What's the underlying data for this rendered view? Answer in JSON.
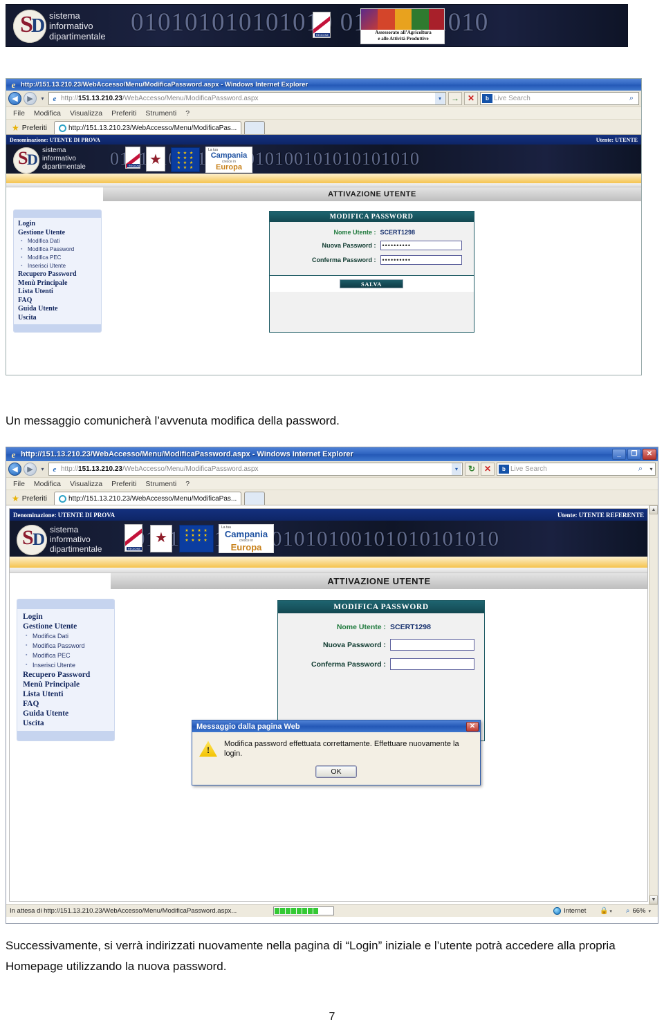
{
  "document": {
    "paragraph_top": "Un messaggio comunicherà l’avvenuta modifica della password.",
    "paragraph_bottom": "Successivamente, si verrà indirizzati nuovamente nella pagina di “Login” iniziale e l’utente potrà accedere alla propria Homepage utilizzando la nuova password.",
    "page_number": "7"
  },
  "masthead": {
    "logo_line1": "sistema",
    "logo_line2": "informativo",
    "logo_line3": "dipartimentale",
    "binary_pattern": "010101010101010                 01010101010",
    "regione_caption": "REGIONE CAMPANIA",
    "agri_caption_line1": "Assessorato all’Agricoltura",
    "agri_caption_line2": "e alle Attività Produttive"
  },
  "browser": {
    "title": "http://151.13.210.23/WebAccesso/Menu/ModificaPassword.aspx - Windows Internet Explorer",
    "address_host": "151.13.210.23",
    "address_prefix": "http://",
    "address_path": "/WebAccesso/Menu/ModificaPassword.aspx",
    "search_placeholder": "Live Search",
    "search_brand": "b",
    "menu": [
      "File",
      "Modifica",
      "Visualizza",
      "Preferiti",
      "Strumenti",
      "?"
    ],
    "favorites_label": "Preferiti",
    "tab_label": "http://151.13.210.23/WebAccesso/Menu/ModificaPas...",
    "minimize_glyph": "_",
    "restore_glyph": "❐",
    "close_glyph": "✕",
    "back_glyph": "◀",
    "forward_glyph": "▶",
    "dropdown_glyph": "▾",
    "go_glyph": "→",
    "refresh_glyph": "↻",
    "stop_glyph": "✕",
    "search_go_glyph": "⌕"
  },
  "status_bar": {
    "text": "In attesa di http://151.13.210.23/WebAccesso/Menu/ModificaPassword.aspx...",
    "zone": "Internet",
    "zoom": "66%",
    "progress_blocks": 8
  },
  "app": {
    "denominazione_label": "Denominazione:",
    "denominazione_value": "UTENTE DI PROVA",
    "utente_label": "Utente:",
    "utente_value_window1": "UTENTE",
    "utente_value_window2": "UTENTE REFERENTE",
    "page_title": "ATTIVAZIONE UTENTE",
    "banner_binary": "01010101010101010100101010101010",
    "crests": {
      "campania_caption": "REGIONE CAMPANIA",
      "eu_stars": "★ ★ ★ ★ ★ ★ ★ ★ ★ ★ ★ ★",
      "campania_l1": "La tua",
      "campania_l2": "Campania",
      "campania_l3": "cresce in",
      "campania_l4": "Europa"
    },
    "menu_items": [
      {
        "label": "Login",
        "type": "main"
      },
      {
        "label": "Gestione Utente",
        "type": "main"
      },
      {
        "label": "Modifica Dati",
        "type": "sub"
      },
      {
        "label": "Modifica Password",
        "type": "sub"
      },
      {
        "label": "Modifica PEC",
        "type": "sub"
      },
      {
        "label": "Inserisci Utente",
        "type": "sub"
      },
      {
        "label": "Recupero Password",
        "type": "main"
      },
      {
        "label": "Menù Principale",
        "type": "main"
      },
      {
        "label": "Lista Utenti",
        "type": "main"
      },
      {
        "label": "FAQ",
        "type": "main"
      },
      {
        "label": "Guida Utente",
        "type": "main"
      },
      {
        "label": "Uscita",
        "type": "main"
      }
    ],
    "password_panel": {
      "heading": "MODIFICA PASSWORD",
      "nome_utente_label": "Nome Utente :",
      "nome_utente_value": "SCERT1298",
      "nuova_password_label": "Nuova Password :",
      "nuova_password_value_filled": "••••••••••",
      "nuova_password_value_empty": "",
      "conferma_password_label": "Conferma Password :",
      "conferma_password_value_filled": "••••••••••",
      "conferma_password_value_empty": "",
      "save_button": "SALVA"
    }
  },
  "dialog": {
    "title": "Messaggio dalla pagina Web",
    "message": "Modifica password effettuata correttamente. Effettuare nuovamente la login.",
    "ok_button": "OK",
    "close_glyph": "✕",
    "warning_glyph": "!"
  },
  "colors": {
    "ie_title_blue": "#2e63c0",
    "app_navy": "#12317f",
    "panel_teal": "#1d5a63",
    "gold_band": "#f5c34e",
    "warning_yellow": "#f3c200",
    "progress_green": "#35c935"
  }
}
